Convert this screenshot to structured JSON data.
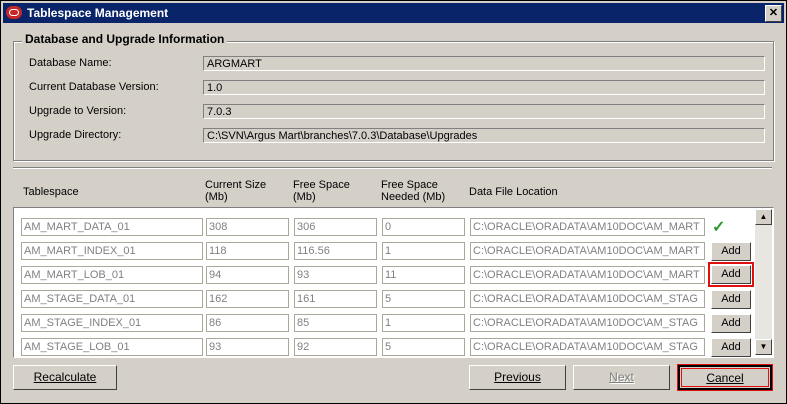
{
  "window": {
    "title": "Tablespace Management",
    "close_glyph": "✕"
  },
  "info": {
    "group_title": "Database and Upgrade Information",
    "db_name_label": "Database Name:",
    "db_name_value": "ARGMART",
    "version_label": "Current Database Version:",
    "version_value": "1.0",
    "upgrade_label": "Upgrade to Version:",
    "upgrade_value": "7.0.3",
    "dir_label": "Upgrade Directory:",
    "dir_value": "C:\\SVN\\Argus Mart\\branches\\7.0.3\\Database\\Upgrades"
  },
  "table": {
    "headers": {
      "tablespace": "Tablespace",
      "current_size_1": "Current Size",
      "current_size_2": "(Mb)",
      "free_space_1": "Free Space",
      "free_space_2": "(Mb)",
      "needed_1": "Free Space",
      "needed_2": "Needed (Mb)",
      "location": "Data File Location"
    },
    "add_label": "Add",
    "ok_icon": "check-icon",
    "rows": [
      {
        "name": "AM_MART_DATA_01",
        "current": "308",
        "free": "306",
        "needed": "0",
        "location": "C:\\ORACLE\\ORADATA\\AM10DOC\\AM_MART",
        "status": "ok"
      },
      {
        "name": "AM_MART_INDEX_01",
        "current": "118",
        "free": "116.56",
        "needed": "1",
        "location": "C:\\ORACLE\\ORADATA\\AM10DOC\\AM_MART",
        "status": "add"
      },
      {
        "name": "AM_MART_LOB_01",
        "current": "94",
        "free": "93",
        "needed": "11",
        "location": "C:\\ORACLE\\ORADATA\\AM10DOC\\AM_MART",
        "status": "add"
      },
      {
        "name": "AM_STAGE_DATA_01",
        "current": "162",
        "free": "161",
        "needed": "5",
        "location": "C:\\ORACLE\\ORADATA\\AM10DOC\\AM_STAG",
        "status": "add"
      },
      {
        "name": "AM_STAGE_INDEX_01",
        "current": "86",
        "free": "85",
        "needed": "1",
        "location": "C:\\ORACLE\\ORADATA\\AM10DOC\\AM_STAG",
        "status": "add"
      },
      {
        "name": "AM_STAGE_LOB_01",
        "current": "93",
        "free": "92",
        "needed": "5",
        "location": "C:\\ORACLE\\ORADATA\\AM10DOC\\AM_STAG",
        "status": "add"
      }
    ]
  },
  "buttons": {
    "recalculate": "Recalculate",
    "previous": "Previous",
    "next": "Next",
    "cancel": "Cancel"
  },
  "colors": {
    "titlebar": "#0a246a",
    "highlight": "#e01010",
    "check": "#2e9b2e"
  }
}
